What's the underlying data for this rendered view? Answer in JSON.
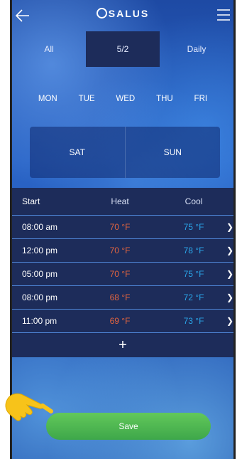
{
  "header": {
    "brand": "SALUS",
    "back_icon": "back-arrow-icon",
    "menu_icon": "hamburger-menu-icon"
  },
  "tabs": [
    {
      "label": "All"
    },
    {
      "label": "5/2"
    },
    {
      "label": "Daily"
    }
  ],
  "active_tab": "5/2",
  "weekdays": [
    "MON",
    "TUE",
    "WED",
    "THU",
    "FRI"
  ],
  "weekend": [
    "SAT",
    "SUN"
  ],
  "schedule": {
    "columns": [
      "Start",
      "Heat",
      "Cool"
    ],
    "rows": [
      {
        "start": "08:00 am",
        "heat": "70 °F",
        "cool": "75 °F"
      },
      {
        "start": "12:00 pm",
        "heat": "70 °F",
        "cool": "78 °F"
      },
      {
        "start": "05:00 pm",
        "heat": "70 °F",
        "cool": "75 °F"
      },
      {
        "start": "08:00 pm",
        "heat": "68 °F",
        "cool": "72 °F"
      },
      {
        "start": "11:00 pm",
        "heat": "69 °F",
        "cool": "73 °F"
      }
    ],
    "add_label": "+"
  },
  "save_label": "Save",
  "colors": {
    "heat": "#e2643f",
    "cool": "#2aa6ea",
    "save_button": "#4cb74f",
    "panel": "#1d2c5a"
  },
  "hand_icon": "pointing-hand-icon"
}
